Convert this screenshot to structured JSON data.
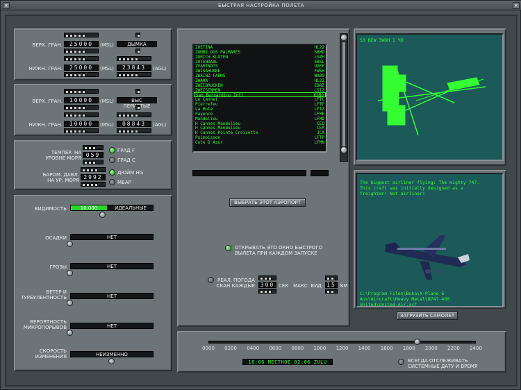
{
  "window": {
    "title": "БЫСТРАЯ НАСТРОЙКА ПОЛЕТА",
    "close": "×"
  },
  "clouds1": {
    "top_label": "ВЕРХ. ГРАН.",
    "top_value": "25000",
    "top_unit": "(MSL)",
    "type": "ДЫМКА",
    "bottom_label": "НИЖН. ГРАН.",
    "bottom_value": "25000",
    "bottom_unit": "(MSL)",
    "agl_value": "23843",
    "agl_unit": "(AGL)"
  },
  "clouds2": {
    "top_label": "ВЕРХ. ГРАН.",
    "top_value": "10000",
    "top_unit": "(MSL)",
    "type": "ВЫС ПЕРИСТЫЕ",
    "bottom_label": "НИЖН. ГРАН.",
    "bottom_value": "10000",
    "bottom_unit": "(MSL)",
    "agl_value": "08843",
    "agl_unit": "(AGL)"
  },
  "sea": {
    "temp_label": "ТЕМПЕР. НА\nУРОВНЕ МОРЯ",
    "temp_value": "059",
    "unit_f": "ГРАД F",
    "unit_c": "ГРАД С",
    "baro_label": "БАРОМ. ДАВЛ.\nНА УР. МОРЯ",
    "baro_value": "2992",
    "unit_inhg": "ДЮЙМ HG",
    "unit_mbar": "МБАР"
  },
  "weather": {
    "visibility_label": "ВИДИМОСТЬ",
    "visibility_value": "10.000",
    "visibility_text": "ИДЕАЛЬНЫЕ",
    "precip_label": "ОСАДКИ",
    "precip_value": "НЕТ",
    "storms_label": "ГРОЗЫ",
    "storms_value": "НЕТ",
    "wind_label": "ВЕТЕР И\nТУРБУЛЕНТНОСТЬ",
    "wind_value": "НЕТ",
    "micro_label": "ВЕРОЯТНОСТЬ\nМИКРОПОРЫВОВ",
    "micro_value": "НЕТ",
    "rate_label": "СКОРОСТЬ\nИЗМЕНЕНИЯ",
    "rate_value": "НЕИЗМЕННО"
  },
  "airports": [
    {
      "name": "ZUETINA",
      "code": "HL22"
    },
    {
      "name": "ZUMBI DOS PALMARES",
      "code": "SBMO"
    },
    {
      "name": "ZURICH KLOTEN",
      "code": "LSZH"
    },
    {
      "name": "ZUTENDAAL",
      "code": "EBSL"
    },
    {
      "name": "ZVARTNOTS",
      "code": "UGEE"
    },
    {
      "name": "ZWISAHUANE",
      "code": "FWSH"
    },
    {
      "name": "ZWAINZ FARMS",
      "code": "WA09"
    },
    {
      "name": "ZWARA",
      "code": "HL22"
    },
    {
      "name": "ZWEIBRUCKEN",
      "code": "EDRZ"
    },
    {
      "name": "ZWEISIMMEN",
      "code": "LSTZ"
    },
    {
      "name": "San Bernardino Intl",
      "code": "KSBD"
    },
    {
      "name": "Le Cannet",
      "code": "LFTC"
    },
    {
      "name": "Pierrefeu",
      "code": "LFTF"
    },
    {
      "name": "La Mole",
      "code": "LFTZ"
    },
    {
      "name": "Fayence",
      "code": "LFMF"
    },
    {
      "name": "Mandelieu",
      "code": "LFMD"
    },
    {
      "name": "H Cannes Mandelieu",
      "code": "CEQ"
    },
    {
      "name": "H Cannes Mandelieu",
      "code": "CER"
    },
    {
      "name": "H Cannes Pointe Croisette",
      "code": "JCA"
    },
    {
      "name": "Puimoisson",
      "code": "LFTP"
    },
    {
      "name": "Cote D Azur",
      "code": "LFMN"
    }
  ],
  "selected_airport_index": 10,
  "search_value": "",
  "select_airport_button": "ВЫБРАТЬ ЭТОТ АЭРОПОРТ",
  "open_on_start": "ОТКРЫВАТЬ ЭТО ОКНО БЫСТРОГО\nВЫЛЕТА ПРИ КАЖДОМ ЗАПУСКЕ",
  "real_weather": {
    "label": "РЕАЛ. ПОГОДА\nСКАН КАЖДЫЕ",
    "value": "300",
    "unit": "СЕК",
    "max_vis_label": "МАКС. ВИД.",
    "max_vis_value": "15",
    "max_vis_unit": "NM"
  },
  "map_screen": {
    "text": "S3  BEW 3WDH    1 ЧЛ"
  },
  "aircraft": {
    "description": "The biggest airliner flying: The mighty 747.\nThis craft was initially designed as a\nfreighter! Not airliner!",
    "path": "C:\\Program Files\\Buka\\X-Plane 6\nAus\\Aircraft\\Heavy Metal\\B747-400\nUnited\\United-Air.acf",
    "load_button": "ЗАГРУЗИТЬ САМОЛЕТ"
  },
  "time": {
    "ticks": [
      "0000",
      "0200",
      "0400",
      "0600",
      "0800",
      "1000",
      "1200",
      "1400",
      "1600",
      "1800",
      "2000",
      "2200",
      "2400"
    ],
    "value": 0.778,
    "readout": "18:06 МЕСТНОЕ   02:06 ZULU",
    "track_label": "ВСЕГДА ОТСЛЕЖИВАТЬ\nСИСТЕМНЫЕ ДАТУ И ВРЕМЯ"
  },
  "colors": {
    "screen_green": "#33ff33",
    "screen_bg": "#1c5a5a",
    "panel": "#6d7477"
  }
}
